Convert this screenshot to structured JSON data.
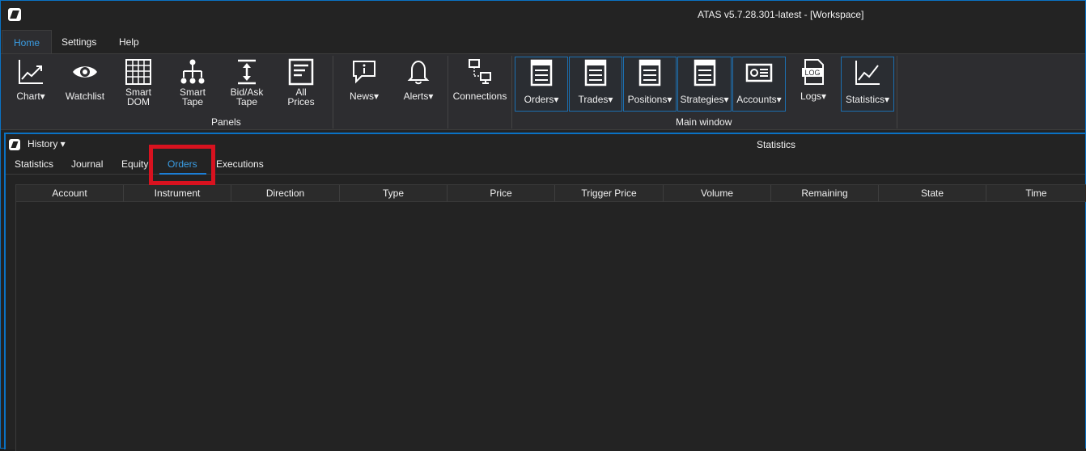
{
  "window": {
    "title": "ATAS v5.7.28.301-latest - [Workspace]"
  },
  "ribbon_tabs": [
    {
      "label": "Home",
      "active": true
    },
    {
      "label": "Settings",
      "active": false
    },
    {
      "label": "Help",
      "active": false
    }
  ],
  "ribbon": {
    "panels_group": "Panels",
    "main_window_group": "Main window",
    "buttons": {
      "chart": "Chart▾",
      "watchlist": "Watchlist",
      "smart_dom": [
        "Smart",
        "DOM"
      ],
      "smart_tape": [
        "Smart",
        "Tape"
      ],
      "bid_ask_tape": [
        "Bid/Ask",
        "Tape"
      ],
      "all_prices": [
        "All",
        "Prices"
      ],
      "news": "News▾",
      "alerts": "Alerts▾",
      "connections": "Connections",
      "orders": "Orders▾",
      "trades": "Trades▾",
      "positions": "Positions▾",
      "strategies": "Strategies▾",
      "accounts": "Accounts▾",
      "logs": "Logs▾",
      "statistics": "Statistics▾",
      "log_icon_text": "LOG"
    }
  },
  "document": {
    "history_label": "History ▾",
    "title": "Statistics",
    "subtabs": [
      {
        "label": "Statistics",
        "active": false
      },
      {
        "label": "Journal",
        "active": false
      },
      {
        "label": "Equity",
        "active": false
      },
      {
        "label": "Orders",
        "active": true
      },
      {
        "label": "Executions",
        "active": false
      }
    ],
    "columns": [
      "Account",
      "Instrument",
      "Direction",
      "Type",
      "Price",
      "Trigger Price",
      "Volume",
      "Remaining",
      "State",
      "Time"
    ]
  },
  "colors": {
    "accent": "#0a72c4",
    "active_text": "#3a9de4",
    "highlight": "#d8121f",
    "background": "#232323"
  }
}
